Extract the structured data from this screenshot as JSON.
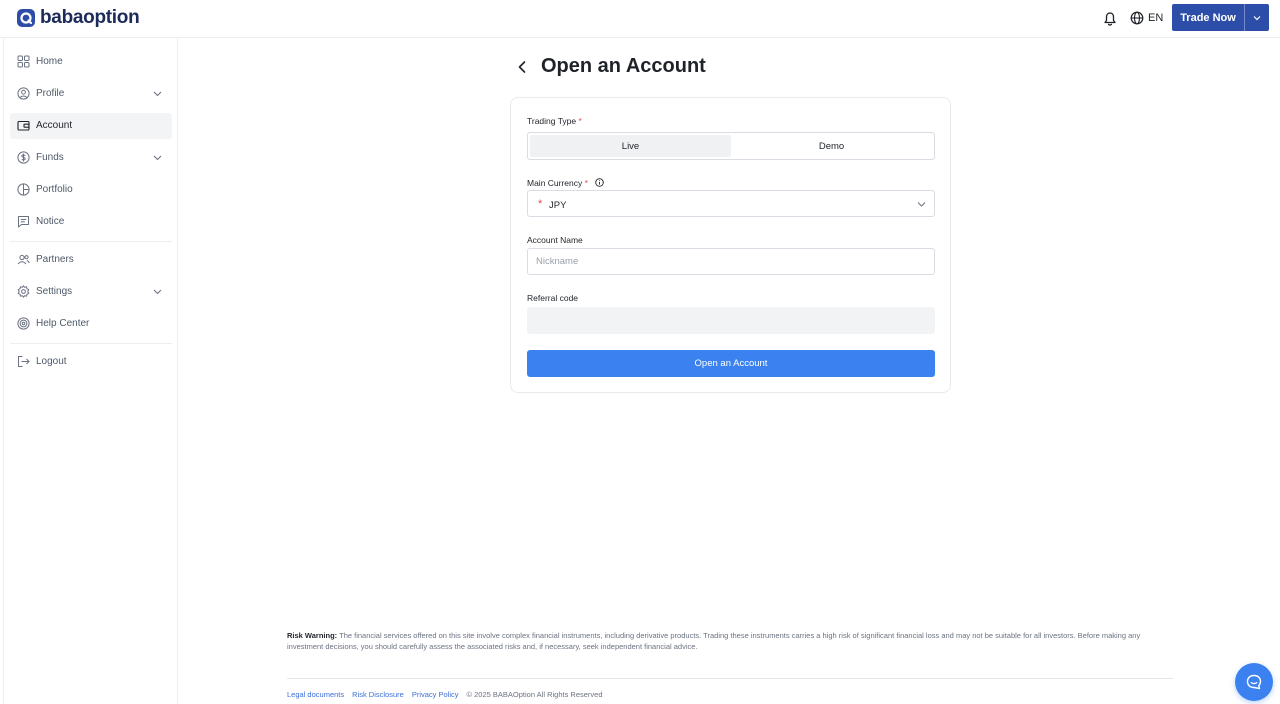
{
  "header": {
    "brand": "babaoption",
    "language": "EN",
    "trade_button": "Trade Now"
  },
  "sidebar": {
    "items": [
      {
        "label": "Home",
        "icon": "grid-icon"
      },
      {
        "label": "Profile",
        "icon": "user-circle-icon",
        "expandable": true
      },
      {
        "label": "Account",
        "icon": "wallet-icon",
        "active": true
      },
      {
        "label": "Funds",
        "icon": "dollar-circle-icon",
        "expandable": true
      },
      {
        "label": "Portfolio",
        "icon": "pie-chart-icon"
      },
      {
        "label": "Notice",
        "icon": "message-icon"
      },
      {
        "label": "Partners",
        "icon": "users-icon"
      },
      {
        "label": "Settings",
        "icon": "gear-icon",
        "expandable": true
      },
      {
        "label": "Help Center",
        "icon": "lifebuoy-icon"
      },
      {
        "label": "Logout",
        "icon": "logout-icon"
      }
    ]
  },
  "main": {
    "title": "Open an Account",
    "form": {
      "trading_type_label": "Trading Type",
      "trading_types": [
        "Live",
        "Demo"
      ],
      "selected_trading_type": "Live",
      "currency_label": "Main Currency",
      "currency_value": "JPY",
      "account_name_label": "Account Name",
      "account_name_placeholder": "Nickname",
      "referral_label": "Referral code",
      "submit_label": "Open an Account",
      "required_marker": "*"
    }
  },
  "footer": {
    "risk_title": "Risk Warning:",
    "risk_text": "The financial services offered on this site involve complex financial instruments, including derivative products. Trading these instruments carries a high risk of significant financial loss and may not be suitable for all investors. Before making any investment decisions, you should carefully assess the associated risks and, if necessary, seek independent financial advice.",
    "links": [
      "Legal documents",
      "Risk Disclosure",
      "Privacy Policy"
    ],
    "copyright": "© 2025 BABAOption All Rights Reserved"
  },
  "colors": {
    "brand_navy": "#2d4ea8",
    "primary_blue": "#3b82f0",
    "required_red": "#e5484d"
  }
}
